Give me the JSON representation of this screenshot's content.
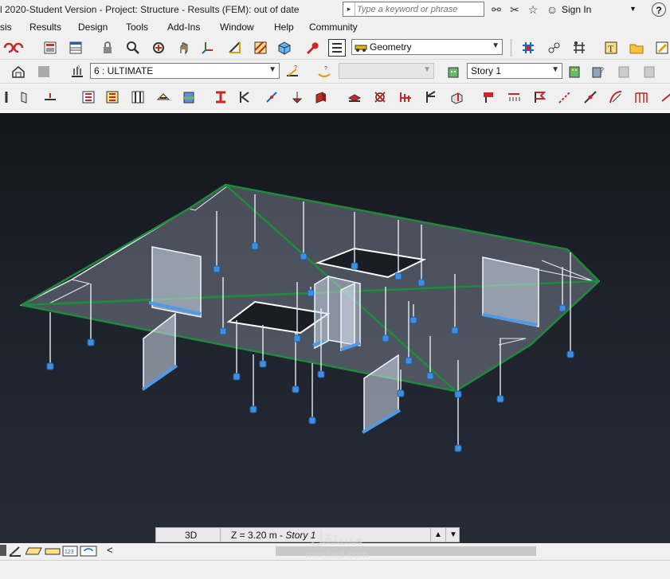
{
  "title_bar": {
    "title": "l 2020-Student Version - Project: Structure - Results (FEM): out of date",
    "search_placeholder": "Type a keyword or phrase",
    "search_dropdown": "▸",
    "sign_in": "Sign In",
    "help": "?"
  },
  "menu": [
    "sis",
    "Results",
    "Design",
    "Tools",
    "Add-Ins",
    "Window",
    "Help",
    "Community"
  ],
  "toolbar1": {
    "geometry_combo": "Geometry"
  },
  "toolbar2": {
    "load_combo": "6 : ULTIMATE",
    "story_combo": "Story 1"
  },
  "status": {
    "view": "3D",
    "z_label": "Z = 3.20 m - ",
    "z_story": "Story 1"
  },
  "bottom": {
    "scroll_left": "<"
  },
  "watermark": {
    "arabic": "مستقل",
    "latin": "mostaql.com"
  },
  "colors": {
    "viewport_bg": "#1e222b",
    "slab_edge": "#1f8a3c",
    "support": "#2e7fd6"
  }
}
